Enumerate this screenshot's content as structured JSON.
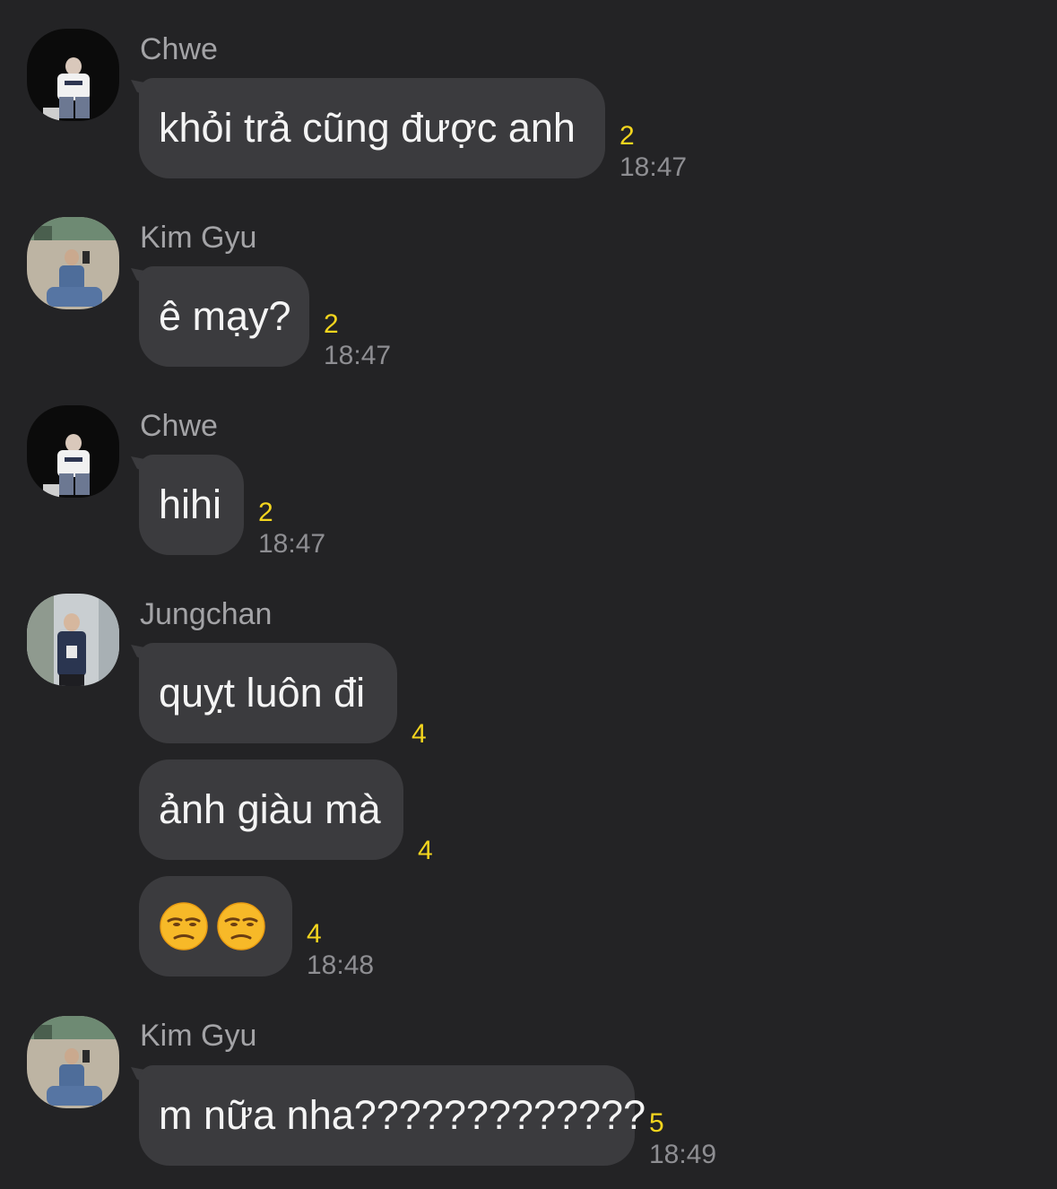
{
  "messages": [
    {
      "sender": "Chwe",
      "text": "khỏi trả cũng được anh",
      "unread": "2",
      "time": "18:47"
    },
    {
      "sender": "Kim Gyu",
      "text": "ê mạy?",
      "unread": "2",
      "time": "18:47"
    },
    {
      "sender": "Chwe",
      "text": "hihi",
      "unread": "2",
      "time": "18:47"
    },
    {
      "sender": "Jungchan",
      "text": "quỵt luôn đi",
      "unread": "4",
      "time": ""
    },
    {
      "sender": "",
      "text": "ảnh giàu mà",
      "unread": "4",
      "time": ""
    },
    {
      "sender": "",
      "emoji": [
        "unamused-face-emoji",
        "unamused-face-emoji"
      ],
      "unread": "4",
      "time": "18:48"
    },
    {
      "sender": "Kim Gyu",
      "text": "m nữa nha?????????????",
      "unread": "5",
      "time": "18:49"
    }
  ],
  "colors": {
    "background": "#232325",
    "bubble": "#3b3b3e",
    "unread": "#f3d51e",
    "time": "#8e8e92",
    "sender": "#a3a3a6"
  }
}
